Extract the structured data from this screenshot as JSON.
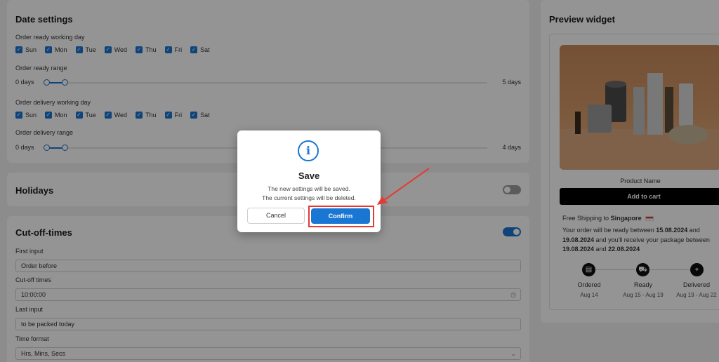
{
  "date_settings": {
    "title": "Date settings",
    "ready_day_label": "Order ready working day",
    "days": [
      "Sun",
      "Mon",
      "Tue",
      "Wed",
      "Thu",
      "Fri",
      "Sat"
    ],
    "ready_range_label": "Order ready range",
    "ready_range": {
      "min_label": "0 days",
      "max_label": "5 days",
      "from": 0,
      "to": 1
    },
    "delivery_day_label": "Order delivery working day",
    "delivery_range_label": "Order delivery range",
    "delivery_range": {
      "min_label": "0 days",
      "max_label": "4 days",
      "from": 0,
      "to": 1
    }
  },
  "holidays": {
    "title": "Holidays",
    "enabled": false
  },
  "cutoff": {
    "title": "Cut-off-times",
    "enabled": true,
    "first_input_label": "First input",
    "first_input_value": "Order before",
    "cutoff_label": "Cut-off times",
    "cutoff_value": "10:00:00",
    "last_input_label": "Last input",
    "last_input_value": "to be packed today",
    "time_format_label": "Time format",
    "time_format_value": "Hrs, Mins, Secs"
  },
  "preview": {
    "title": "Preview widget",
    "product_name": "Product Name",
    "add_to_cart": "Add to cart",
    "shipping_prefix": "Free Shipping to",
    "shipping_country": "Singapore",
    "ready_p1": "Your order will be ready between ",
    "ready_d1": "15.08.2024",
    "ready_p2": " and ",
    "ready_d2": "19.08.2024",
    "ready_p3": " and you'll receive your package between ",
    "ready_d3": "19.08.2024",
    "ready_p4": " and ",
    "ready_d4": "22.08.2024",
    "steps": [
      {
        "label": "Ordered",
        "date": "Aug 14",
        "icon": "clipboard-icon"
      },
      {
        "label": "Ready",
        "date": "Aug 15 - Aug 19",
        "icon": "truck-icon"
      },
      {
        "label": "Delivered",
        "date": "Aug 19 - Aug 22",
        "icon": "location-pin-icon"
      }
    ]
  },
  "modal": {
    "icon": "info-icon",
    "title": "Save",
    "message_line1": "The new settings will be saved.",
    "message_line2": "The current settings will be deleted.",
    "cancel_label": "Cancel",
    "confirm_label": "Confirm"
  },
  "colors": {
    "accent": "#1976d2",
    "highlight": "#e53935"
  }
}
